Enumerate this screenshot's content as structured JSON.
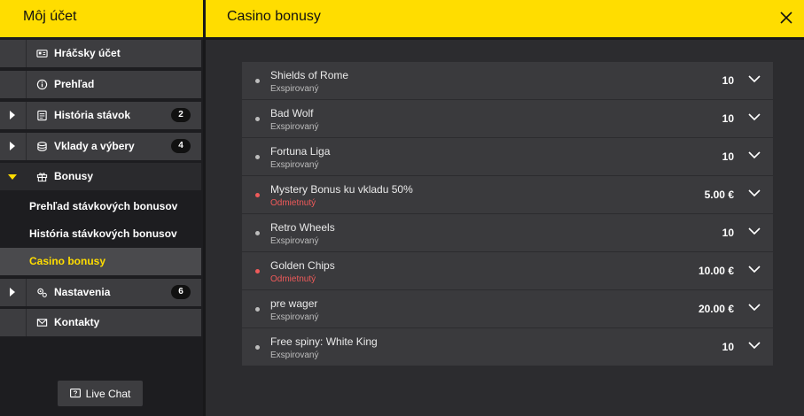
{
  "header": {
    "left_title": "Môj účet",
    "right_title": "Casino bonusy"
  },
  "sidebar": {
    "items": [
      {
        "label": "Hráčsky účet",
        "icon": "id-card-icon",
        "has_arrow": false
      },
      {
        "label": "Prehľad",
        "icon": "info-icon",
        "has_arrow": false
      },
      {
        "label": "História stávok",
        "icon": "receipt-icon",
        "has_arrow": true,
        "badge": "2"
      },
      {
        "label": "Vklady a výbery",
        "icon": "coins-icon",
        "has_arrow": true,
        "badge": "4"
      },
      {
        "label": "Bonusy",
        "icon": "gift-icon",
        "has_arrow": true,
        "expanded": true
      },
      {
        "label": "Nastavenia",
        "icon": "gears-icon",
        "has_arrow": true,
        "badge": "6"
      },
      {
        "label": "Kontakty",
        "icon": "envelope-icon",
        "has_arrow": false
      }
    ],
    "sub_items": [
      {
        "label": "Prehľad stávkových bonusov"
      },
      {
        "label": "História stávkových bonusov"
      },
      {
        "label": "Casino bonusy",
        "active": true
      }
    ],
    "live_chat_label": "Live Chat"
  },
  "bonuses": [
    {
      "name": "Shields of Rome",
      "status": "Exspirovaný",
      "amount": "10",
      "state": "expired"
    },
    {
      "name": "Bad Wolf",
      "status": "Exspirovaný",
      "amount": "10",
      "state": "expired"
    },
    {
      "name": "Fortuna Liga",
      "status": "Exspirovaný",
      "amount": "10",
      "state": "expired"
    },
    {
      "name": "Mystery Bonus ku vkladu 50%",
      "status": "Odmietnutý",
      "amount": "5.00 €",
      "state": "rejected"
    },
    {
      "name": "Retro Wheels",
      "status": "Exspirovaný",
      "amount": "10",
      "state": "expired"
    },
    {
      "name": "Golden Chips",
      "status": "Odmietnutý",
      "amount": "10.00 €",
      "state": "rejected"
    },
    {
      "name": "pre wager",
      "status": "Exspirovaný",
      "amount": "20.00 €",
      "state": "expired"
    },
    {
      "name": "Free spiny: White King",
      "status": "Exspirovaný",
      "amount": "10",
      "state": "expired"
    }
  ],
  "colors": {
    "accent": "#ffdd00",
    "rejected": "#ef5a5a",
    "panel": "#3a3a3d"
  }
}
